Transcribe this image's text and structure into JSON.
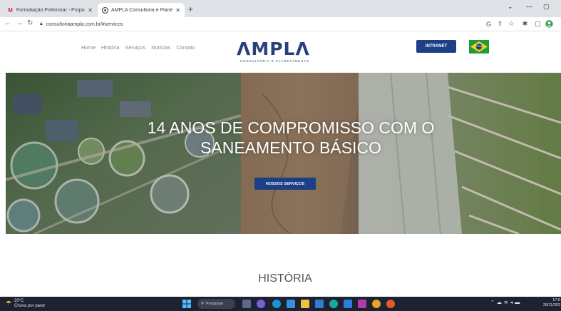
{
  "browser": {
    "tabs": [
      {
        "label": "Formatação Preliminar - Proposta",
        "icon": "gmail-icon"
      },
      {
        "label": "AMPLA Consultoria e Planejamento",
        "icon": "site-icon"
      }
    ],
    "new_tab_symbol": "+",
    "url": "consultoriaampla.com.br/#servicos",
    "window_controls": {
      "minimize": "—",
      "maximize": "▢",
      "chevron": "⌄"
    }
  },
  "site": {
    "nav": [
      "Home",
      "História",
      "Serviços",
      "Notícias",
      "Contato"
    ],
    "logo": {
      "word": "ΛMPLΛ",
      "tagline": "CONSULTORIA E PLANEJAMENTO"
    },
    "intranet_label": "INTRANET",
    "language_flag": "brazil-flag"
  },
  "hero": {
    "title": "14 ANOS DE COMPROMISSO COM O SANEAMENTO BÁSICO",
    "button_label": "NOSSOS SERVIÇOS"
  },
  "section": {
    "title": "HISTÓRIA"
  },
  "taskbar": {
    "weather_temp": "20°C",
    "weather_desc": "Chuva por parar",
    "search_label": "Pesquisar",
    "time": "17:0",
    "date": "29/11/202"
  },
  "colors": {
    "brand_blue": "#1d3f86",
    "logo_blue": "#2a3f7e",
    "taskbar_bg": "#1d2230"
  }
}
